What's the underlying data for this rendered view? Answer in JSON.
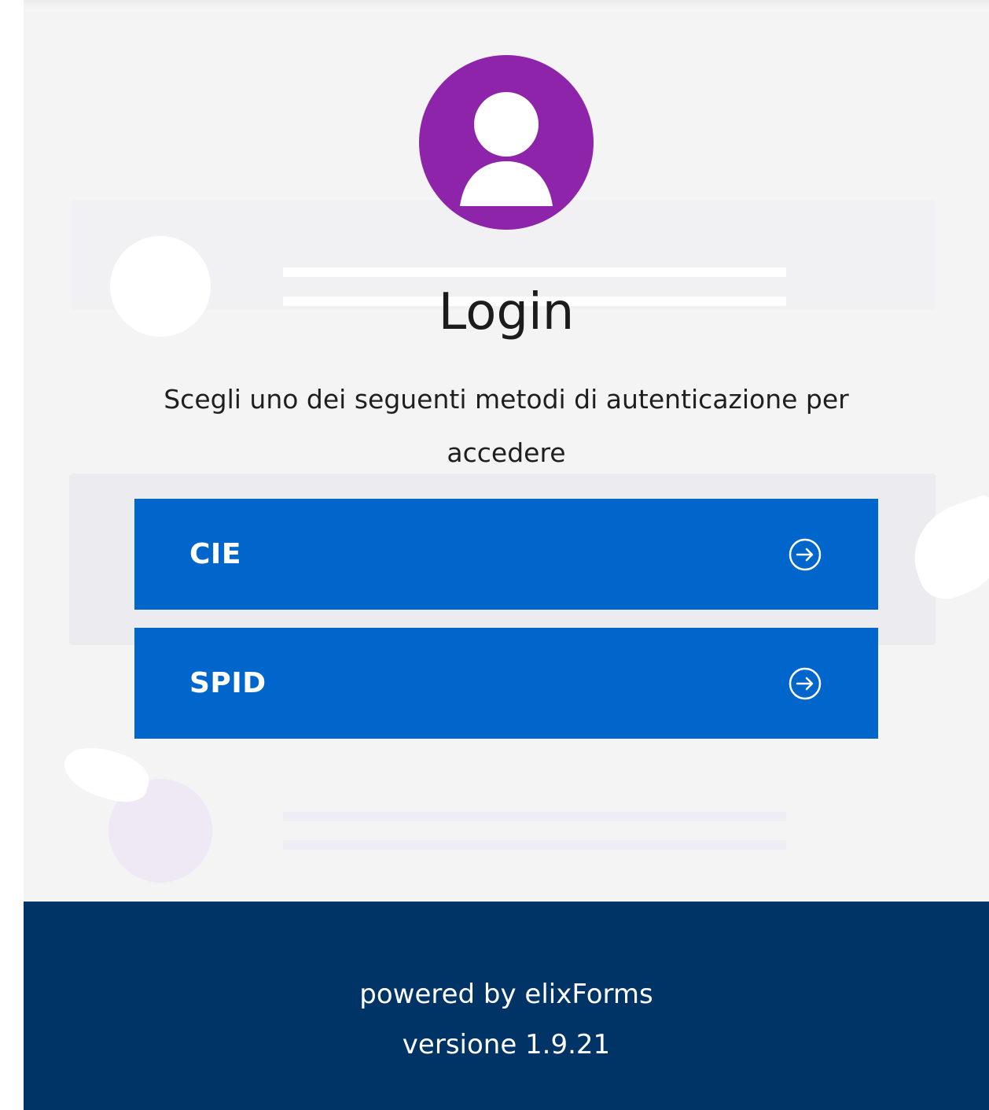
{
  "login": {
    "title": "Login",
    "subtitle": "Scegli uno dei seguenti metodi di autenticazione per accedere",
    "buttons": [
      {
        "label": "CIE",
        "icon": "arrow-right-circle-icon"
      },
      {
        "label": "SPID",
        "icon": "arrow-right-circle-icon"
      }
    ]
  },
  "avatar": {
    "icon": "user-icon"
  },
  "footer": {
    "powered_by": "powered by elixForms",
    "version": "versione 1.9.21"
  },
  "colors": {
    "avatar": "#8e24aa",
    "button": "#0066cc",
    "footer": "#003366",
    "background": "#f4f4f5"
  }
}
